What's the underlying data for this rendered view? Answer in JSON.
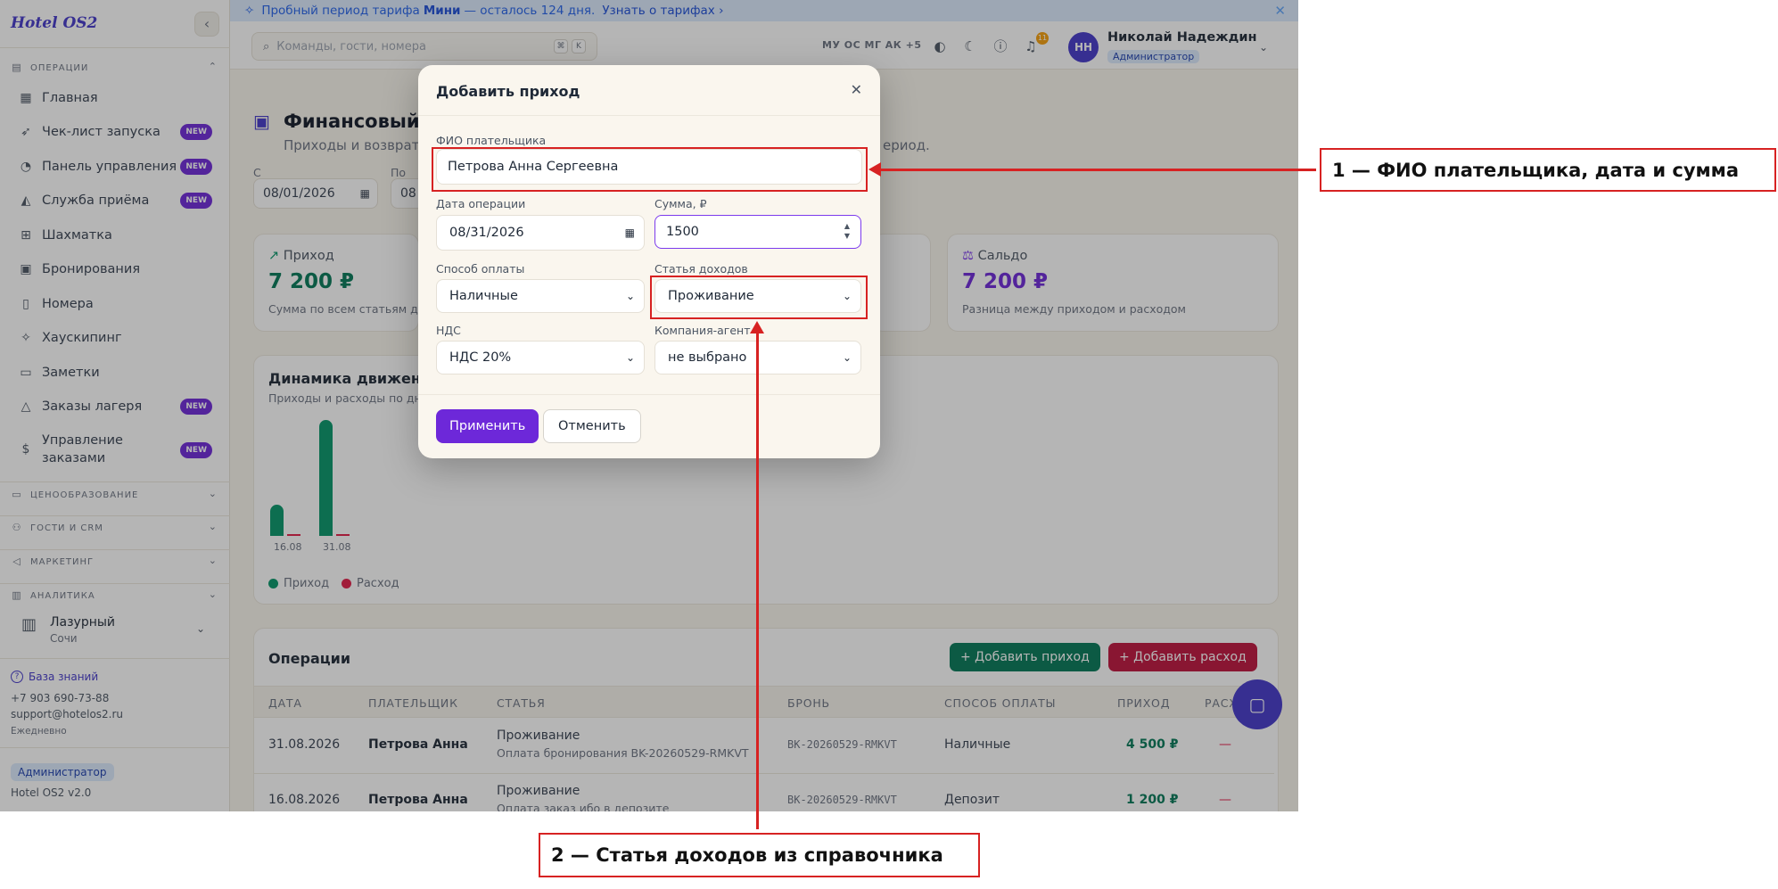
{
  "app": {
    "logo": "Hotel OS2",
    "collapse_icon": "chevron-left-icon"
  },
  "sidebar": {
    "sections": [
      {
        "label": "ОПЕРАЦИИ",
        "expanded": true
      },
      {
        "label": "ЦЕНООБРАЗОВАНИЕ",
        "expanded": false
      },
      {
        "label": "ГОСТИ И CRM",
        "expanded": false
      },
      {
        "label": "МАРКЕТИНГ",
        "expanded": false
      },
      {
        "label": "АНАЛИТИКА",
        "expanded": false
      }
    ],
    "items": [
      {
        "label": "Главная",
        "icon": "dashboard-icon",
        "badge": ""
      },
      {
        "label": "Чек-лист запуска",
        "icon": "rocket-icon",
        "badge": "NEW"
      },
      {
        "label": "Панель управления",
        "icon": "gauge-icon",
        "badge": "NEW"
      },
      {
        "label": "Служба приёма",
        "icon": "bell-icon",
        "badge": "NEW"
      },
      {
        "label": "Шахматка",
        "icon": "grid-icon",
        "badge": ""
      },
      {
        "label": "Бронирования",
        "icon": "calendar-icon",
        "badge": ""
      },
      {
        "label": "Номера",
        "icon": "door-icon",
        "badge": ""
      },
      {
        "label": "Хаускипинг",
        "icon": "sparkle-icon",
        "badge": ""
      },
      {
        "label": "Заметки",
        "icon": "note-icon",
        "badge": ""
      },
      {
        "label": "Заказы лагеря",
        "icon": "tent-icon",
        "badge": "NEW"
      },
      {
        "label": "Управление заказами",
        "icon": "receipt-icon",
        "badge": "NEW"
      }
    ],
    "hotel": {
      "name": "Лазурный",
      "city": "Сочи"
    },
    "kb_link": "База знаний",
    "phone": "+7 903 690-73-88",
    "email": "support@hotelos2.ru",
    "hours": "Ежедневно",
    "role": "Администратор",
    "version": "Hotel OS2 v2.0"
  },
  "trial": {
    "prefix": "Пробный период тарифа",
    "plan": "Мини",
    "suffix": "— осталось 124 дня.",
    "link": "Узнать о тарифах ›",
    "close_icon": "close-icon"
  },
  "header": {
    "search_placeholder": "Команды, гости, номера",
    "kbd1": "⌘",
    "kbd2": "K",
    "avatars": "МУ ОС МГ АК +5",
    "notif_count": "11",
    "user_initials": "НН",
    "user_name": "Николай Надеждин",
    "user_role": "Администратор"
  },
  "page": {
    "title": "Финансовый уч",
    "subtitle": "Приходы и возвраты",
    "subtitle_right": "ериод.",
    "from_label": "С",
    "to_label": "По",
    "from_date": "08/01/2026",
    "to_date": "08"
  },
  "stats": [
    {
      "label": "Приход",
      "value": "7 200 ₽",
      "note": "Сумма по всем статьям дох"
    },
    {
      "label": "Сальдо",
      "value": "7 200 ₽",
      "note": "Разница между приходом и расходом"
    }
  ],
  "chart": {
    "title": "Динамика движения",
    "subtitle": "Приходы и расходы по дня",
    "legend_income": "Приход",
    "legend_expense": "Расход"
  },
  "chart_data": {
    "type": "bar",
    "categories": [
      "16.08",
      "31.08"
    ],
    "series": [
      {
        "name": "Приход",
        "values": [
          1200,
          4500
        ]
      },
      {
        "name": "Расход",
        "values": [
          0,
          0
        ]
      }
    ],
    "colors": {
      "income": "#059669",
      "expense": "#e11d48"
    }
  },
  "operations": {
    "title": "Операции",
    "add_income": "+ Добавить приход",
    "add_expense": "+ Добавить расход",
    "columns": [
      "ДАТА",
      "ПЛАТЕЛЬЩИК",
      "СТАТЬЯ",
      "БРОНЬ",
      "СПОСОБ ОПЛАТЫ",
      "ПРИХОД",
      "РАСХОД"
    ],
    "rows": [
      {
        "date": "31.08.2026",
        "payer": "Петрова Анна",
        "article": "Проживание",
        "article_note": "Оплата бронирования BK-20260529-RMKVT",
        "booking": "BK-20260529-RMKVT",
        "method": "Наличные",
        "income": "4 500 ₽",
        "expense": "—"
      },
      {
        "date": "16.08.2026",
        "payer": "Петрова Анна",
        "article": "Проживание",
        "article_note": "Оплата заказ ибо в депозите",
        "booking": "BK-20260529-RMKVT",
        "method": "Депозит",
        "income": "1 200 ₽",
        "expense": "—"
      }
    ]
  },
  "modal": {
    "title": "Добавить приход",
    "payer_label": "ФИО плательщика",
    "payer_value": "Петрова Анна Сергеевна",
    "date_label": "Дата операции",
    "date_value": "08/31/2026",
    "sum_label": "Сумма, ₽",
    "sum_value": "1500",
    "method_label": "Способ оплаты",
    "method_value": "Наличные",
    "article_label": "Статья доходов",
    "article_value": "Проживание",
    "vat_label": "НДС",
    "vat_value": "НДС 20%",
    "agent_label": "Компания-агент",
    "agent_value": "не выбрано",
    "apply": "Применить",
    "cancel": "Отменить"
  },
  "annotations": {
    "a1": "1 — ФИО плательщика, дата и сумма",
    "a2": "2 — Статья доходов из справочника",
    "color": "#d72222"
  }
}
